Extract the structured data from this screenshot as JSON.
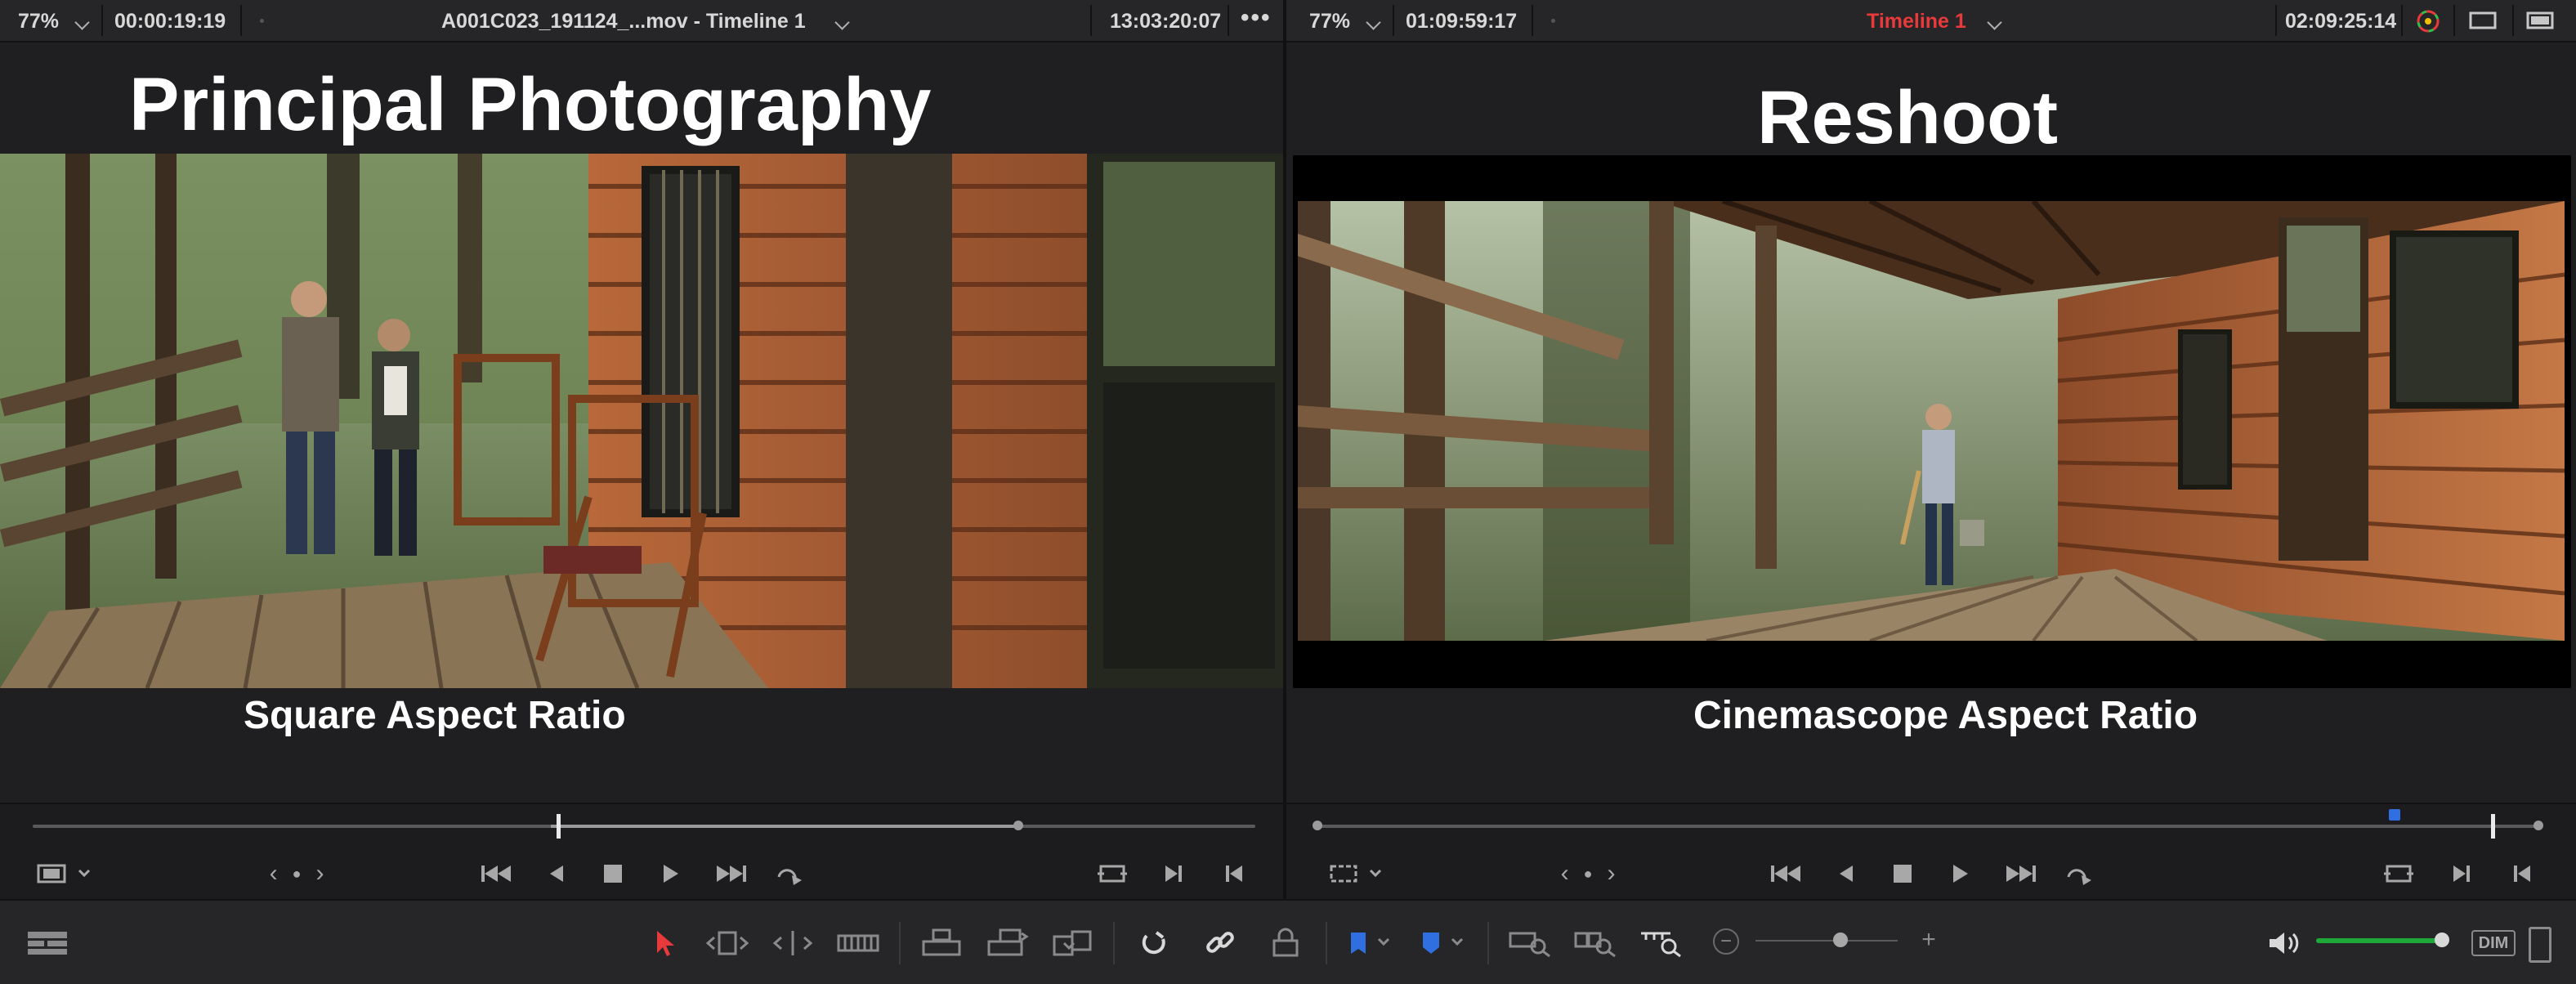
{
  "source_viewer": {
    "zoom": "77%",
    "timecode_left": "00:00:19:19",
    "clip_name": "A001C023_191124_...mov - Timeline 1",
    "timecode_right": "13:03:20:07",
    "title": "Principal Photography",
    "caption": "Square Aspect Ratio",
    "playhead_progress": 0.43
  },
  "timeline_viewer": {
    "zoom": "77%",
    "timecode_left": "01:09:59:17",
    "timeline_name": "Timeline 1",
    "timecode_right": "02:09:25:14",
    "title": "Reshoot",
    "caption": "Cinemascope Aspect Ratio",
    "playhead_progress": 0.96,
    "marker_progress": 0.88
  },
  "colors": {
    "timeline_name": "#e8393b",
    "select_tool": "#e8393b",
    "marker_flag": "#2f6fe0",
    "volume_bar": "#1fa83a"
  },
  "icons": {
    "transport": [
      "skip-start-icon",
      "step-back-icon",
      "stop-icon",
      "play-icon",
      "skip-end-icon",
      "loop-icon"
    ],
    "toolbar": [
      "timeline-view-icon",
      "selection-pointer-icon",
      "trim-edit-icon",
      "dynamic-trim-icon",
      "blade-icon",
      "insert-clip-icon",
      "overwrite-clip-icon",
      "replace-clip-icon",
      "snapping-icon",
      "linked-selection-icon",
      "position-lock-icon",
      "flag-icon",
      "marker-icon",
      "full-extent-zoom-icon",
      "detail-zoom-icon",
      "custom-zoom-icon",
      "volume-icon"
    ]
  },
  "toolbar": {
    "zoom_level": 0.6,
    "volume_level": 0.96,
    "dim_label": "DIM",
    "zoom_minus": "−",
    "zoom_plus": "+"
  }
}
